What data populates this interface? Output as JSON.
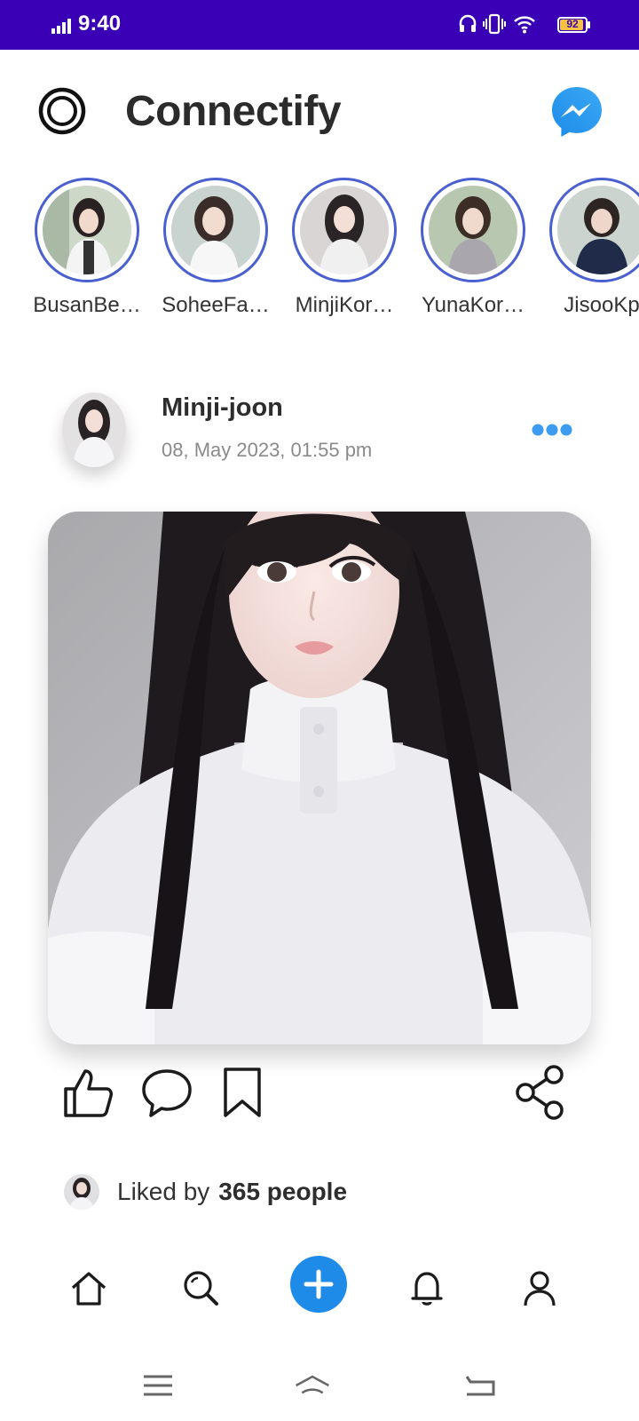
{
  "status_bar": {
    "time": "9:40",
    "battery": "92",
    "battery_level": 0.92,
    "icons": [
      "signal-icon",
      "headphones-icon",
      "vibrate-icon",
      "wifi-icon",
      "battery-icon"
    ]
  },
  "header": {
    "title": "Connectify",
    "logo_icon": "app-logo-icon",
    "messenger_icon": "messenger-icon",
    "accent": "#1e8be8"
  },
  "stories": [
    {
      "name": "BusanBe…"
    },
    {
      "name": "SoheeFa…"
    },
    {
      "name": "MinjiKor…"
    },
    {
      "name": "YunaKor…"
    },
    {
      "name": "JisooKp"
    }
  ],
  "post": {
    "username": "Minji-joon",
    "date": "08, May 2023, 01:55 pm",
    "more_icon": "more-dots-icon"
  },
  "actions": {
    "icons": [
      "like-icon",
      "comment-icon",
      "bookmark-icon",
      "share-icon"
    ]
  },
  "likes": {
    "prefix": "Liked by",
    "count": "365 people"
  },
  "bottom_nav": {
    "items": [
      "home-icon",
      "search-icon",
      "add-icon",
      "notifications-icon",
      "profile-icon"
    ]
  },
  "system_nav": {
    "items": [
      "menu-icon",
      "home-icon",
      "back-icon"
    ]
  },
  "colors": {
    "status_bar": "#3a00b5",
    "story_ring": "#4a5fd0",
    "add_button": "#1e8be8"
  }
}
